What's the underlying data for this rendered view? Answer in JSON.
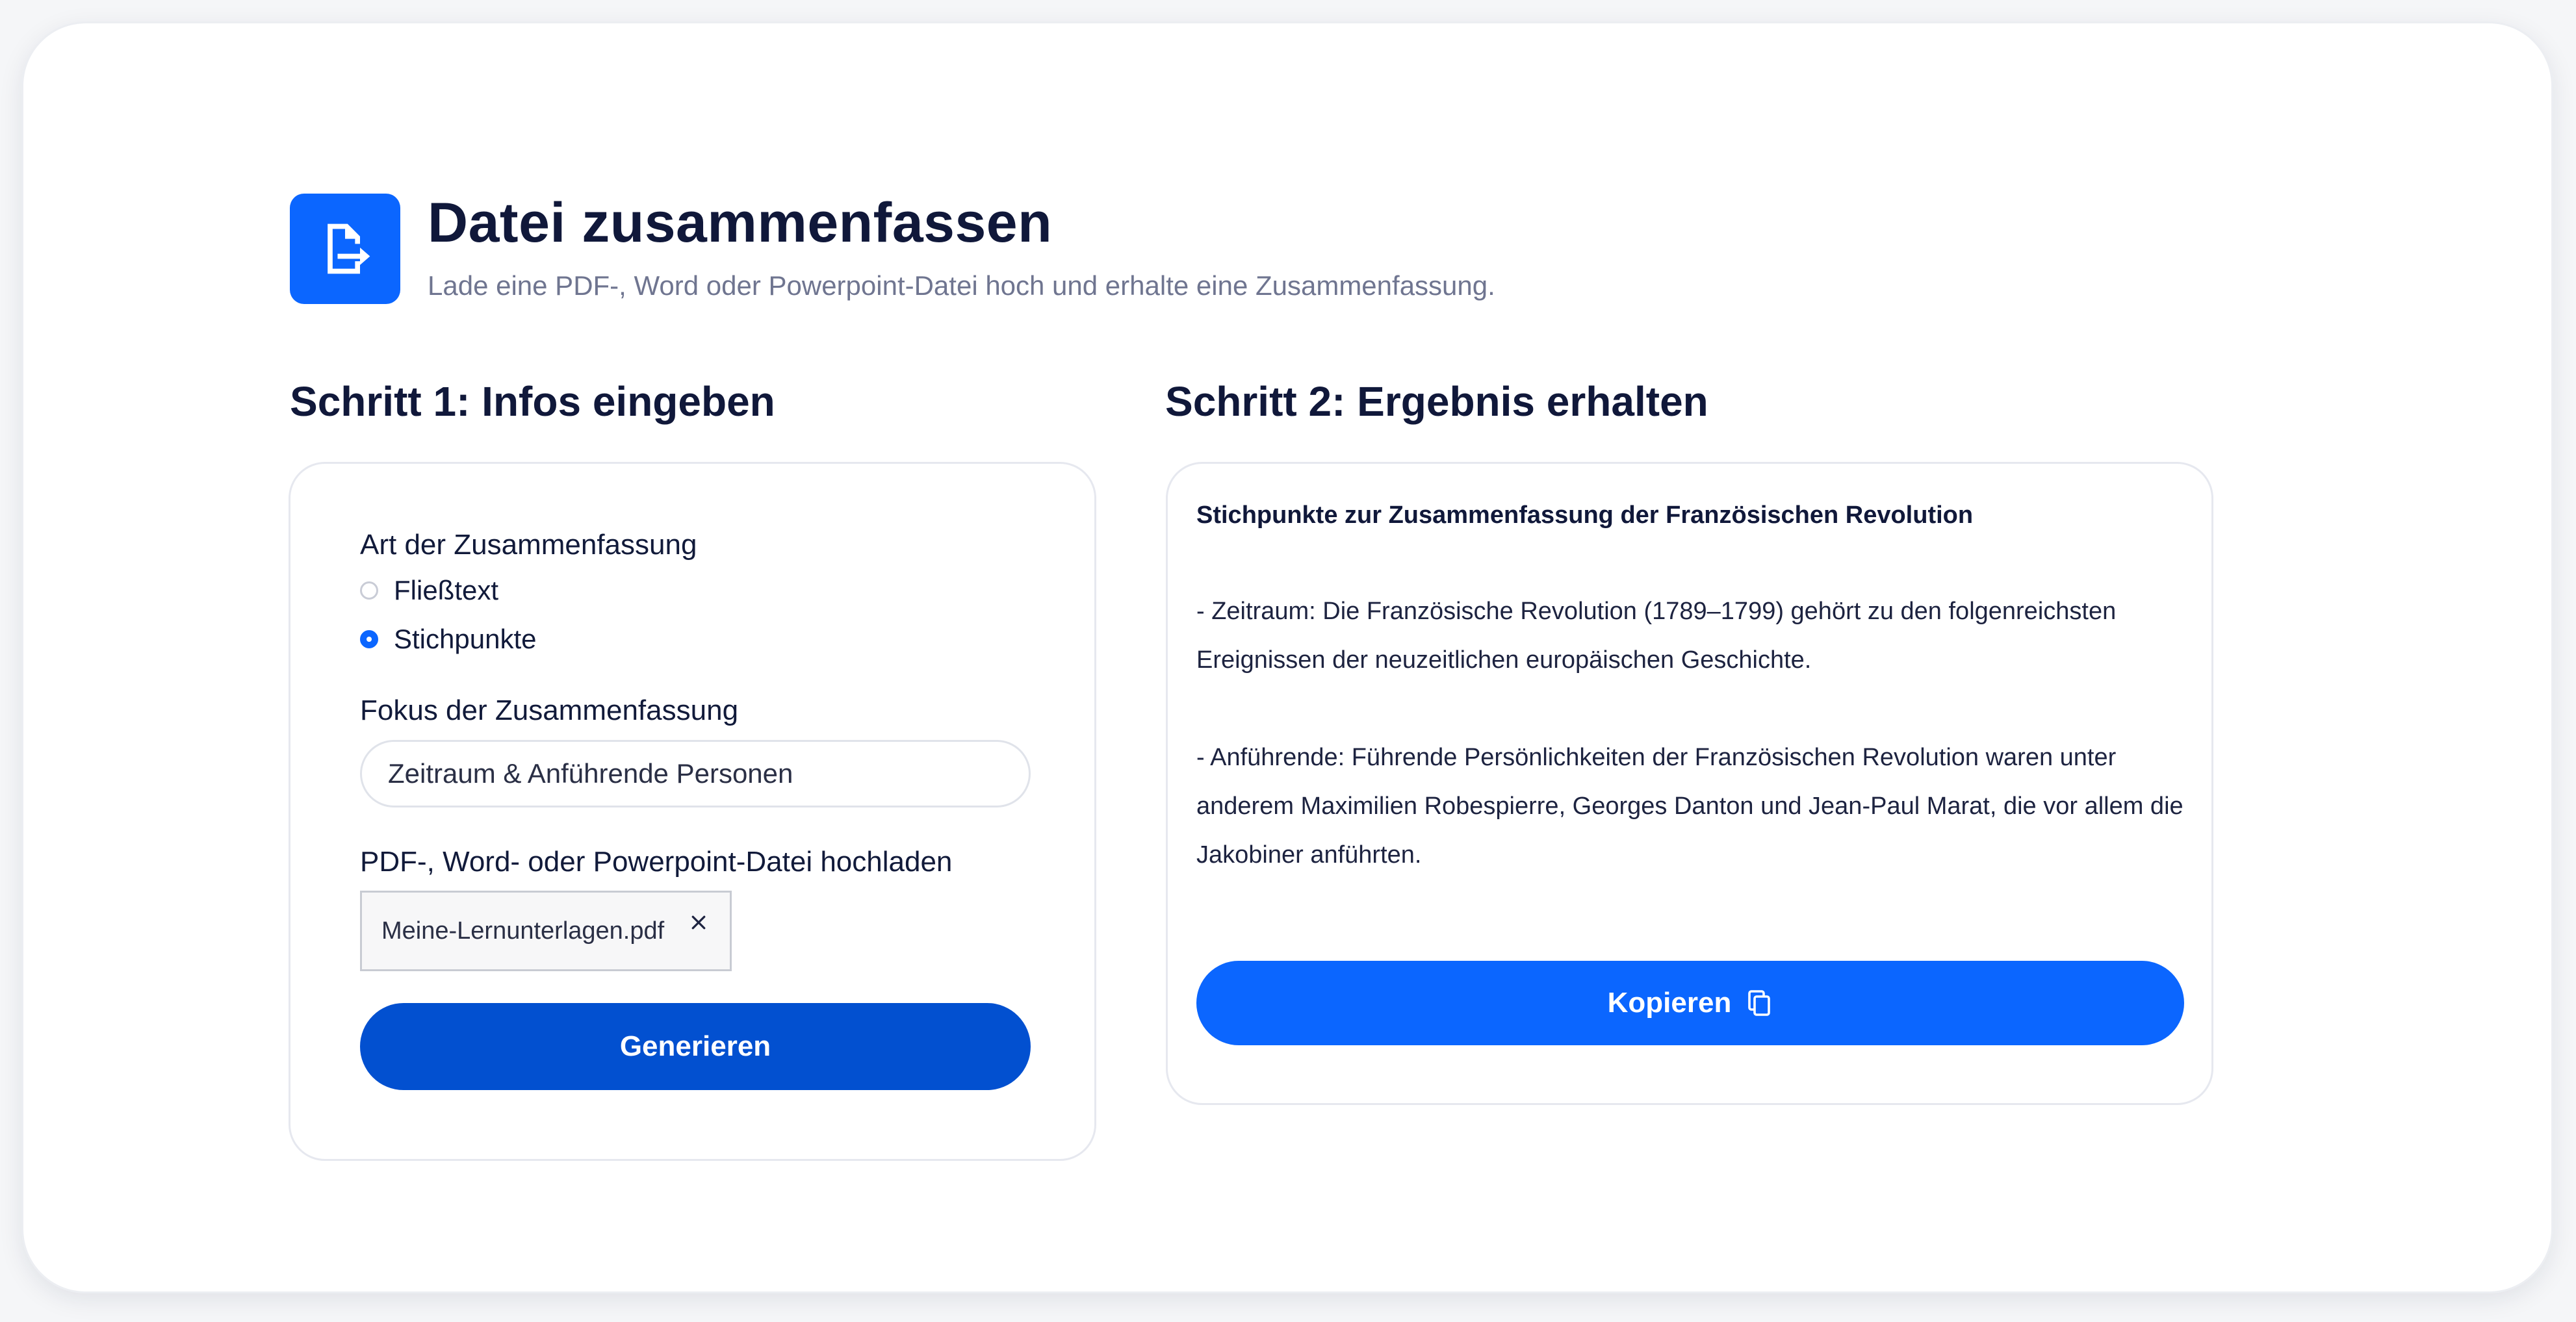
{
  "header": {
    "title": "Datei zusammenfassen",
    "subtitle": "Lade eine PDF-, Word oder Powerpoint-Datei hoch und erhalte eine Zusammenfassung.",
    "icon": "file-export-icon"
  },
  "step1": {
    "heading": "Schritt 1: Infos eingeben",
    "summary_type_label": "Art der Zusammenfassung",
    "options": [
      {
        "label": "Fließtext",
        "checked": false
      },
      {
        "label": "Stichpunkte",
        "checked": true
      }
    ],
    "focus_label": "Fokus der Zusammenfassung",
    "focus_value": "Zeitraum & Anführende Personen",
    "upload_label": "PDF-, Word- oder Powerpoint-Datei hochladen",
    "file_name": "Meine-Lernunterlagen.pdf",
    "generate_label": "Generieren"
  },
  "step2": {
    "heading": "Schritt 2: Ergebnis erhalten",
    "result_title": "Stichpunkte zur Zusammenfassung der Französischen Revolution",
    "result_paragraphs": [
      "- Zeitraum: Die Französische Revolution (1789–1799) gehört zu den folgenreichsten Ereignissen der neuzeitlichen europäischen Geschichte.",
      "- Anführende: Führende Persönlichkeiten der Französischen Revolution waren unter anderem Maximilien Robespierre, Georges Danton und Jean-Paul Marat, die vor allem die Jakobiner anführten."
    ],
    "copy_label": "Kopieren"
  },
  "colors": {
    "accent": "#0b66ff",
    "button_dark": "#0250d0",
    "text_dark": "#10183a",
    "text_muted": "#6f7590"
  }
}
